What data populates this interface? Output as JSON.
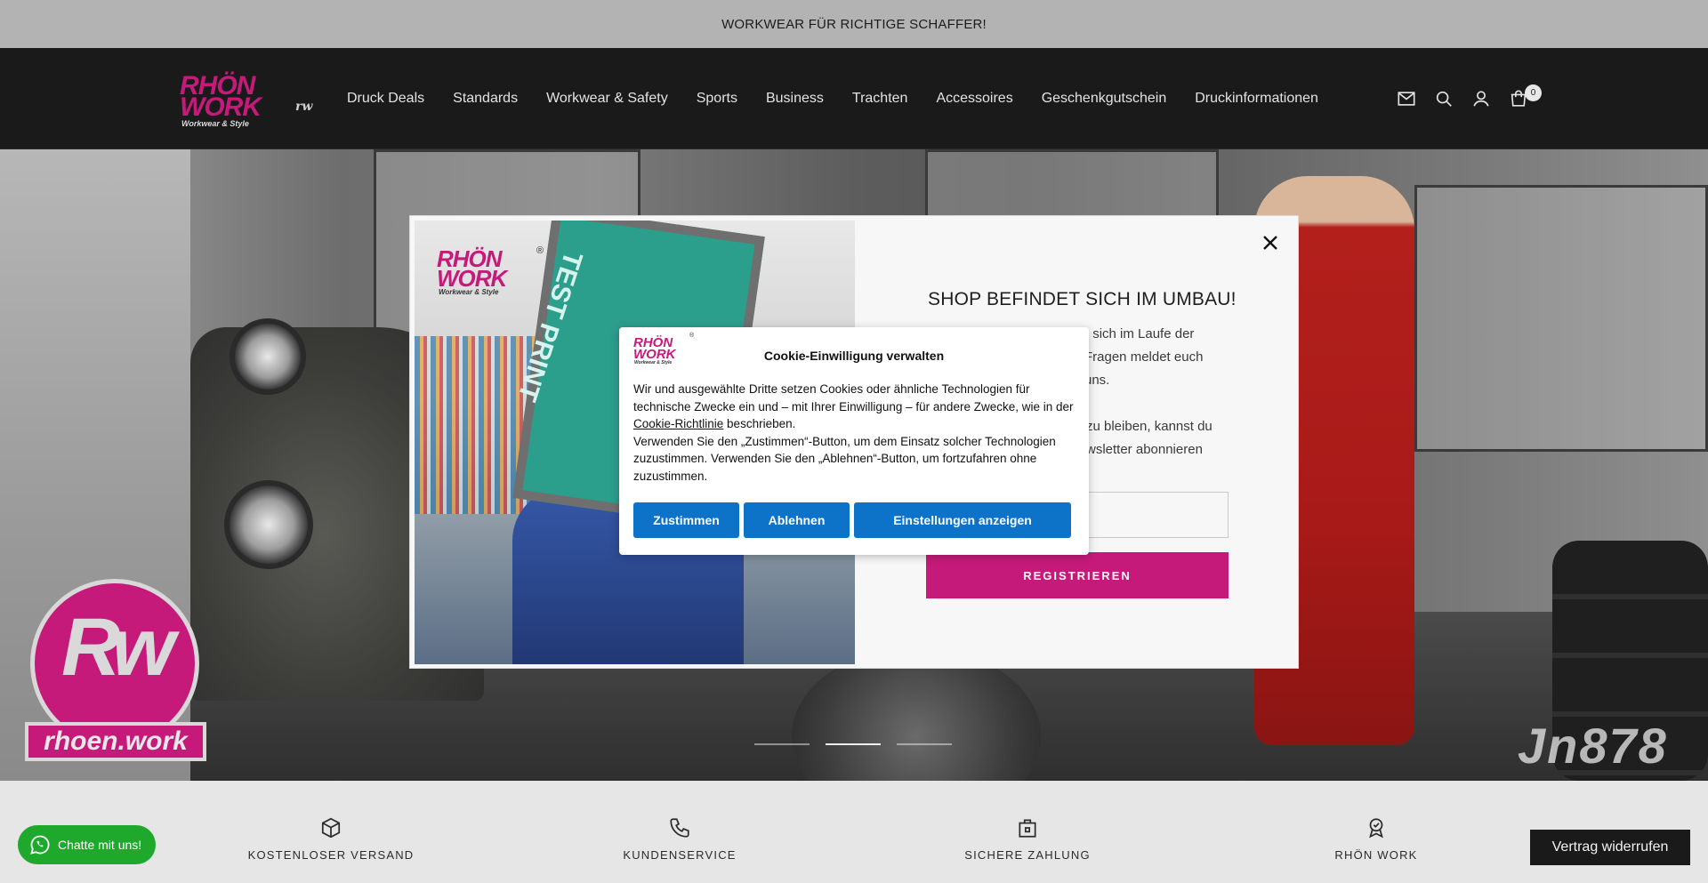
{
  "announcement": "WORKWEAR FÜR RICHTIGE SCHAFFER!",
  "header": {
    "logo": {
      "line1": "RHÖN",
      "line2": "WORK",
      "tagline": "Workwear & Style"
    },
    "nav": [
      "Druck Deals",
      "Standards",
      "Workwear & Safety",
      "Sports",
      "Business",
      "Trachten",
      "Accessoires",
      "Geschenkgutschein",
      "Druckinformationen"
    ],
    "icons": [
      "mail-icon",
      "search-icon",
      "account-icon",
      "cart-icon"
    ],
    "cart_count": "0"
  },
  "hero": {
    "badge_mark": "Rw",
    "badge_label": "rhoen.work",
    "watermark": "Jn878",
    "slides": 3,
    "active_slide": 2
  },
  "newsletter": {
    "logo": {
      "line1": "RHÖN",
      "line2": "WORK",
      "tagline": "Workwear & Style",
      "registered": "®"
    },
    "image_text": "TEST PRINT",
    "title": "SHOP BEFINDET SICH IM UMBAU!",
    "text_line1": "rden sich im Laufe der",
    "text_line2": "Fragen meldet euch",
    "text_line3": "uns.",
    "text_line4": "zu bleiben, kannst du",
    "text_line5": "wsletter abonnieren",
    "submit_label": "REGISTRIEREN"
  },
  "cookie_banner": {
    "logo": {
      "line1": "RHÖN",
      "line2": "WORK",
      "tagline": "Workwear & Style",
      "registered": "®"
    },
    "title": "Cookie-Einwilligung verwalten",
    "text_part1": "Wir und ausgewählte Dritte setzen Cookies oder ähnliche Technologien für technische Zwecke ein und – mit Ihrer Einwilligung – für andere Zwecke, wie in der ",
    "policy_link": "Cookie-Richtlinie",
    "text_part2": " beschrieben.",
    "text_para2": "Verwenden Sie den „Zustimmen“-Button, um dem Einsatz solcher Technologien zuzustimmen. Verwenden Sie den „Ablehnen“-Button, um fortzufahren ohne zuzustimmen.",
    "accept_label": "Zustimmen",
    "reject_label": "Ablehnen",
    "settings_label": "Einstellungen anzeigen",
    "button_color": "#0d73c8"
  },
  "features": [
    {
      "label": "KOSTENLOSER VERSAND",
      "icon": "box-icon"
    },
    {
      "label": "KUNDENSERVICE",
      "icon": "phone-icon"
    },
    {
      "label": "SICHERE ZAHLUNG",
      "icon": "lock-bag-icon"
    },
    {
      "label": "RHÖN WORK",
      "icon": "award-icon"
    }
  ],
  "chat_button": "Chatte mit uns!",
  "revoke_button": "Vertrag widerrufen",
  "colors": {
    "brand_magenta": "#c51a7a",
    "header_bg": "#1a1a1a",
    "announcement_bg": "#b3b3b3",
    "whatsapp_green": "#1ea82c"
  }
}
